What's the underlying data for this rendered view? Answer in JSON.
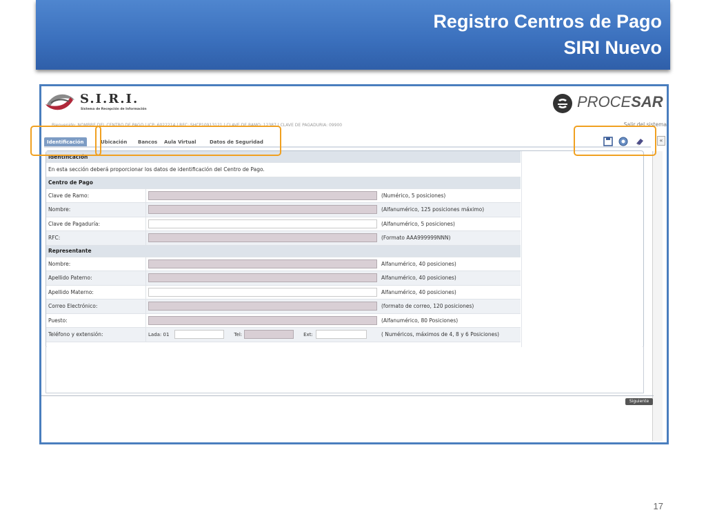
{
  "slide": {
    "title_line1": "Registro Centros de Pago",
    "title_line2": "SIRI Nuevo",
    "page_number": "17"
  },
  "header": {
    "logo_text": "S.I.R.I.",
    "logo_subtitle": "Sistema de Recepción de Información",
    "brand_procesar_a": "PROCE",
    "brand_procesar_b": "SAR",
    "info_line": "Bienvenido: NOMBRE DEL CENTRO DE PAGO | ICP: 6022214 | RFC: SHCP10913121 | CLAVE DE RAMO: 12387 | CLAVE DE PAGADURIA: 09900",
    "logout": "Salir del sistema"
  },
  "tabs": [
    {
      "label": "Identificación",
      "active": true
    },
    {
      "label": "Ubicación",
      "active": false
    },
    {
      "label": "Bancos",
      "active": false
    },
    {
      "label": "Aula Virtual",
      "active": false
    },
    {
      "label": "Datos de Seguridad",
      "active": false
    }
  ],
  "toolbar": {
    "icons": [
      "save-icon",
      "help-icon",
      "eraser-icon"
    ],
    "collapse": "«"
  },
  "form": {
    "section_title": "Identificación",
    "description": "En esta sección deberá proporcionar los datos de identificación del Centro de Pago.",
    "centro_title": "Centro de Pago",
    "centro_rows": [
      {
        "label": "Clave de Ramo:",
        "hint": "(Numérico, 5 posiciones)",
        "style": "pink"
      },
      {
        "label": "Nombre:",
        "hint": "(Alfanumérico, 125 posiciones máximo)",
        "style": "pink"
      },
      {
        "label": "Clave de Pagaduría:",
        "hint": "(Alfanumérico, 5 posiciones)",
        "style": "white"
      },
      {
        "label": "RFC:",
        "hint": "(Formato AAA999999NNN)",
        "style": "pink"
      }
    ],
    "rep_title": "Representante",
    "rep_rows": [
      {
        "label": "Nombre:",
        "hint": "Alfanumérico, 40 posiciones)",
        "style": "pink"
      },
      {
        "label": "Apellido Paterno:",
        "hint": "Alfanumérico, 40 posiciones)",
        "style": "pink"
      },
      {
        "label": "Apellido Materno:",
        "hint": "Alfanumérico, 40 posiciones)",
        "style": "white"
      },
      {
        "label": "Correo Electrónico:",
        "hint": "(formato de correo, 120 posiciones)",
        "style": "pink"
      },
      {
        "label": "Puesto:",
        "hint": "(Alfanumérico, 80 Posiciones)",
        "style": "pink"
      }
    ],
    "phone": {
      "label": "Teléfono y extensión:",
      "lada_label": "Lada: 01",
      "tel_label": "Tel:",
      "ext_label": "Ext:",
      "hint": "( Numéricos, máximos de 4, 8 y 6 Posiciones)"
    },
    "next_button": "Siguiente"
  },
  "colors": {
    "banner": "#3a6fbc",
    "highlight": "#f0a020",
    "active_tab": "#7d9cc4",
    "field_fill": "#d9cfd5"
  }
}
